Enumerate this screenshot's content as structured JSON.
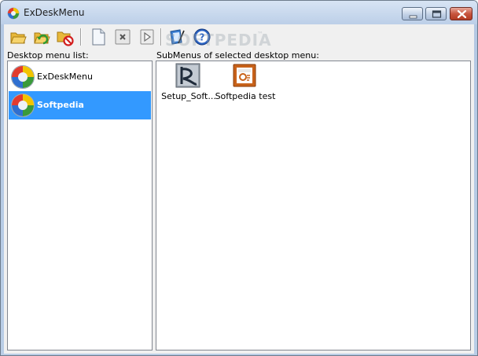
{
  "window": {
    "title": "ExDeskMenu",
    "app_icon": "exdeskmenu-logo-icon"
  },
  "title_buttons": {
    "minimize": "minimize-icon",
    "maximize": "maximize-icon",
    "close": "close-icon"
  },
  "toolbar": {
    "buttons": [
      {
        "name": "open-folder-button",
        "icon": "open-folder-icon"
      },
      {
        "name": "refresh-folder-button",
        "icon": "refresh-folder-icon"
      },
      {
        "name": "remove-folder-button",
        "icon": "no-entry-folder-icon"
      },
      {
        "name": "new-item-button",
        "icon": "new-document-icon"
      },
      {
        "name": "delete-item-button",
        "icon": "delete-x-icon"
      },
      {
        "name": "run-item-button",
        "icon": "play-icon"
      },
      {
        "name": "properties-button",
        "icon": "pen-tablet-icon"
      },
      {
        "name": "help-button",
        "icon": "help-question-icon"
      }
    ]
  },
  "watermark": "SOFTPEDIA",
  "watermark_tm": "™",
  "left_pane": {
    "label": "Desktop menu list:",
    "items": [
      {
        "label": "ExDeskMenu",
        "icon": "exdeskmenu-logo-icon",
        "selected": false
      },
      {
        "label": "Softpedia",
        "icon": "exdeskmenu-logo-icon",
        "selected": true
      }
    ]
  },
  "right_pane": {
    "label": "SubMenus of selected desktop menu:",
    "items": [
      {
        "label": "Setup_Soft...",
        "icon": "setup-installer-icon"
      },
      {
        "label": "Softpedia test",
        "icon": "presentation-file-icon"
      }
    ]
  },
  "colors": {
    "selection": "#3399ff",
    "pane_border": "#828790",
    "client_background": "#f0f0f0"
  }
}
